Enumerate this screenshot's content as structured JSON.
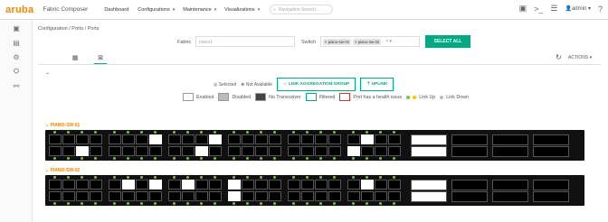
{
  "app": {
    "logo": "aruba",
    "name": "Fabric Composer"
  },
  "nav": [
    {
      "label": "Dashboard",
      "caret": ""
    },
    {
      "label": "Configurations",
      "caret": "▼"
    },
    {
      "label": "Maintenance",
      "caret": "▼"
    },
    {
      "label": "Visualizations",
      "caret": "▼"
    }
  ],
  "search": {
    "placeholder": "Navigation Search..."
  },
  "user": {
    "name": "admin"
  },
  "breadcrumb": "Configuration / Ports / Ports",
  "filters": {
    "fabric_label": "Fabric",
    "fabric_value": "piano1",
    "switch_label": "Switch",
    "switch_chips": [
      "piano-sw-01",
      "piano-sw-02"
    ],
    "select_all": "SELECT ALL"
  },
  "toolbar": {
    "actions_label": "ACTIONS"
  },
  "legend": {
    "selected": "Selected",
    "not_available": "Not Available",
    "link_agg": "LINK AGGREGATION GROUP",
    "uplink": "UPLINK",
    "enabled": "Enabled",
    "disabled": "Disabled",
    "no_transceiver": "No Transceiver",
    "filtered": "Filtered",
    "health_issue": "Port has a health issue",
    "link_up": "Link Up",
    "link_down": "Link Down"
  },
  "switches": [
    {
      "name": "PIANO-SW-01",
      "top_enabled": [
        7,
        11,
        21,
        27
      ],
      "bottom_enabled": [
        4,
        20,
        40
      ],
      "big_enabled": [
        0
      ]
    },
    {
      "name": "PIANO-SW-02",
      "top_enabled": [
        5,
        7,
        9,
        12,
        21,
        24,
        26
      ],
      "bottom_enabled": [
        9,
        24
      ],
      "big_enabled": [
        0
      ]
    }
  ],
  "colors": {
    "accent": "#01a982",
    "brand": "#ff8300",
    "link_up": "#7cc243"
  }
}
